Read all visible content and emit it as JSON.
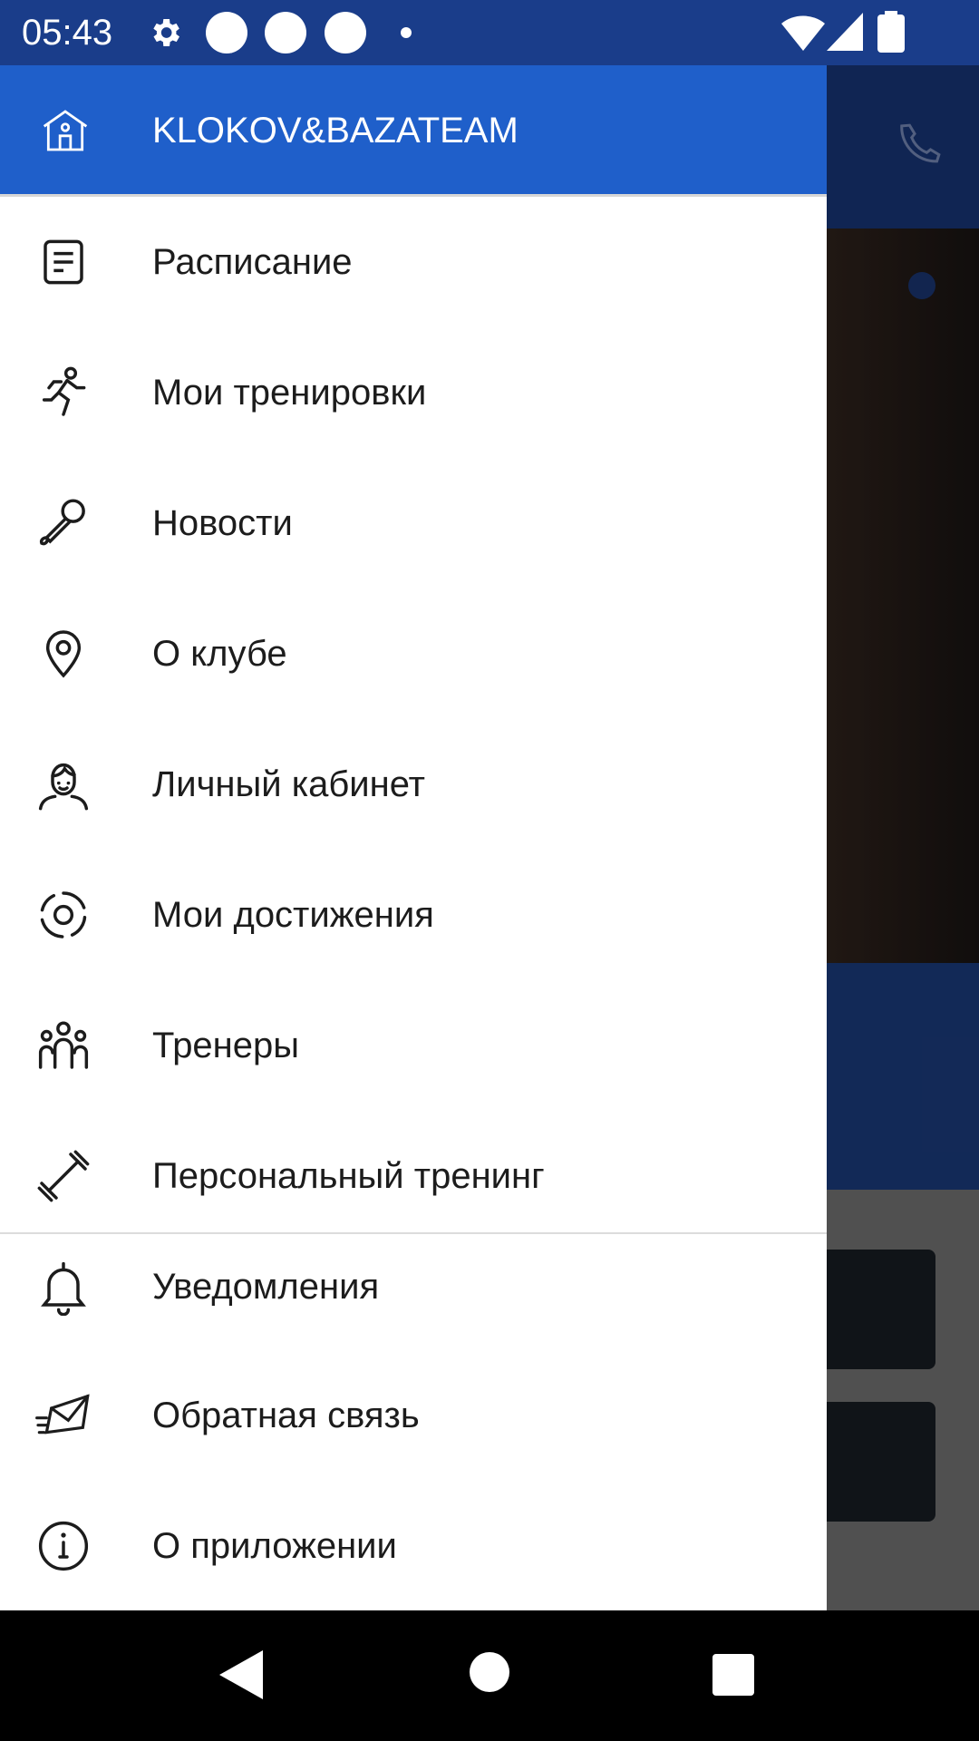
{
  "status_bar": {
    "time": "05:43",
    "icons": [
      "settings-icon",
      "app-badge-icon",
      "app-badge-icon",
      "app-badge-icon",
      "notification-dot-icon",
      "wifi-icon",
      "signal-icon",
      "battery-icon"
    ]
  },
  "drawer": {
    "header_title": "KLOKOV&BAZATEAM",
    "header_icon": "home-icon",
    "items": [
      {
        "label": "Расписание",
        "icon": "schedule-icon"
      },
      {
        "label": "Мои тренировки",
        "icon": "runner-icon"
      },
      {
        "label": "Новости",
        "icon": "microphone-icon"
      },
      {
        "label": "О клубе",
        "icon": "location-pin-icon"
      },
      {
        "label": "Личный кабинет",
        "icon": "user-profile-icon"
      },
      {
        "label": "Мои достижения",
        "icon": "achievements-icon"
      },
      {
        "label": "Тренеры",
        "icon": "trainers-icon"
      },
      {
        "label": "Персональный тренинг",
        "icon": "dumbbell-icon"
      }
    ],
    "footer_items": [
      {
        "label": "Уведомления",
        "icon": "bell-icon"
      },
      {
        "label": "Обратная связь",
        "icon": "mail-icon"
      },
      {
        "label": "О приложении",
        "icon": "info-icon"
      }
    ]
  },
  "background": {
    "phone_icon": "phone-icon"
  },
  "nav_bar": {
    "back": "back-icon",
    "home": "home-circle-icon",
    "recents": "recents-icon"
  },
  "colors": {
    "header_blue": "#1f5fca",
    "status_blue": "#1a3d8a"
  }
}
